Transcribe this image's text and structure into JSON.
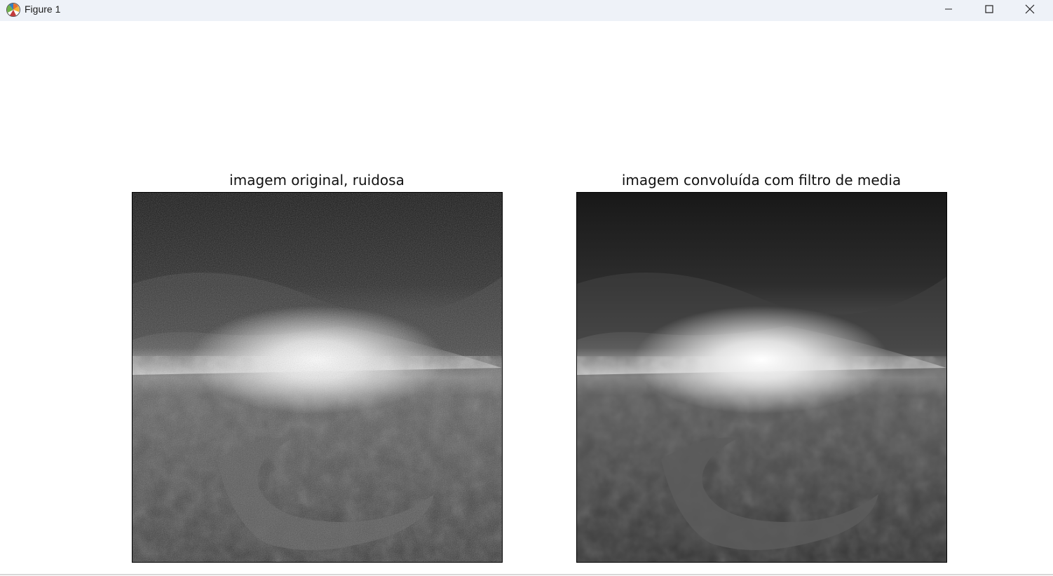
{
  "window": {
    "title": "Figure 1",
    "icon": "matplotlib-logo-icon",
    "controls": [
      "minimize-icon",
      "maximize-icon",
      "close-icon"
    ]
  },
  "subplots": [
    {
      "title": "imagem original, ruidosa",
      "image": "grayscale-landscape-noisy"
    },
    {
      "title": "imagem convoluída com filtro de media",
      "image": "grayscale-landscape-smoothed"
    }
  ],
  "colors": {
    "titlebar": "#eef2f8",
    "figure_background": "#ffffff"
  }
}
